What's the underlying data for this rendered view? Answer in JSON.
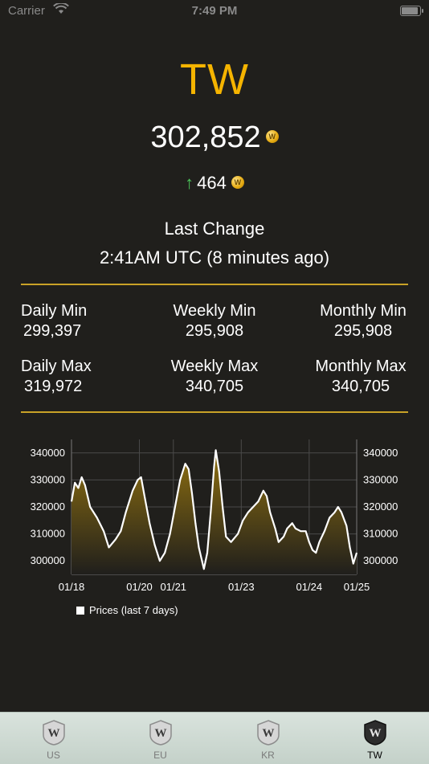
{
  "status_bar": {
    "carrier": "Carrier",
    "time": "7:49 PM"
  },
  "region": {
    "title": "TW",
    "title_color": "#f5b400"
  },
  "price": {
    "value": "302,852",
    "coin_icon": "gold-coin-icon"
  },
  "change": {
    "direction": "up",
    "value": "464"
  },
  "last_change": {
    "label": "Last Change",
    "time": "2:41AM UTC (8 minutes ago)"
  },
  "stats": {
    "daily_min": {
      "label": "Daily Min",
      "value": "299,397"
    },
    "weekly_min": {
      "label": "Weekly Min",
      "value": "295,908"
    },
    "monthly_min": {
      "label": "Monthly Min",
      "value": "295,908"
    },
    "daily_max": {
      "label": "Daily Max",
      "value": "319,972"
    },
    "weekly_max": {
      "label": "Weekly Max",
      "value": "340,705"
    },
    "monthly_max": {
      "label": "Monthly Max",
      "value": "340,705"
    }
  },
  "chart_data": {
    "type": "area",
    "ylim": [
      295000,
      345000
    ],
    "y_ticks": [
      "340000",
      "330000",
      "320000",
      "310000",
      "300000"
    ],
    "x_ticks": [
      "01/18",
      "01/20",
      "01/21",
      "01/23",
      "01/24",
      "01/25"
    ],
    "legend": "Prices (last 7 days)",
    "grid": true,
    "series": [
      {
        "name": "Prices (last 7 days)",
        "points": [
          [
            0.0,
            322000
          ],
          [
            0.1,
            329000
          ],
          [
            0.2,
            327000
          ],
          [
            0.3,
            331000
          ],
          [
            0.4,
            328000
          ],
          [
            0.55,
            320000
          ],
          [
            0.75,
            316000
          ],
          [
            0.95,
            311000
          ],
          [
            1.1,
            305000
          ],
          [
            1.3,
            308000
          ],
          [
            1.45,
            311000
          ],
          [
            1.6,
            318000
          ],
          [
            1.8,
            326000
          ],
          [
            1.95,
            330000
          ],
          [
            2.05,
            331000
          ],
          [
            2.15,
            324000
          ],
          [
            2.3,
            314000
          ],
          [
            2.45,
            306000
          ],
          [
            2.6,
            300000
          ],
          [
            2.75,
            303000
          ],
          [
            2.9,
            310000
          ],
          [
            3.05,
            320000
          ],
          [
            3.2,
            330000
          ],
          [
            3.35,
            336000
          ],
          [
            3.45,
            334000
          ],
          [
            3.55,
            325000
          ],
          [
            3.65,
            314000
          ],
          [
            3.75,
            305000
          ],
          [
            3.9,
            297000
          ],
          [
            4.0,
            303000
          ],
          [
            4.1,
            318000
          ],
          [
            4.2,
            335000
          ],
          [
            4.25,
            341000
          ],
          [
            4.35,
            333000
          ],
          [
            4.45,
            320000
          ],
          [
            4.55,
            309000
          ],
          [
            4.7,
            307000
          ],
          [
            4.9,
            310000
          ],
          [
            5.05,
            315000
          ],
          [
            5.2,
            318000
          ],
          [
            5.35,
            320000
          ],
          [
            5.5,
            322000
          ],
          [
            5.65,
            326000
          ],
          [
            5.75,
            324000
          ],
          [
            5.85,
            318000
          ],
          [
            6.0,
            312000
          ],
          [
            6.1,
            307000
          ],
          [
            6.25,
            309000
          ],
          [
            6.35,
            312000
          ],
          [
            6.5,
            314000
          ],
          [
            6.6,
            312000
          ],
          [
            6.75,
            311000
          ],
          [
            6.9,
            311000
          ],
          [
            7.0,
            307000
          ],
          [
            7.1,
            304000
          ],
          [
            7.2,
            303000
          ],
          [
            7.3,
            307000
          ],
          [
            7.45,
            311000
          ],
          [
            7.6,
            316000
          ],
          [
            7.75,
            318000
          ],
          [
            7.85,
            320000
          ],
          [
            7.95,
            318000
          ],
          [
            8.1,
            313000
          ],
          [
            8.2,
            305000
          ],
          [
            8.3,
            299000
          ],
          [
            8.4,
            303000
          ]
        ]
      }
    ],
    "fill_top_color": "#8f7010",
    "fill_bottom_color": "#201f1c",
    "line_color": "#ffffff"
  },
  "tabs": [
    {
      "label": "US",
      "icon": "wow-token-badge-icon",
      "active": false
    },
    {
      "label": "EU",
      "icon": "wow-token-badge-icon",
      "active": false
    },
    {
      "label": "KR",
      "icon": "wow-token-badge-icon",
      "active": false
    },
    {
      "label": "TW",
      "icon": "wow-token-badge-icon",
      "active": true
    }
  ]
}
